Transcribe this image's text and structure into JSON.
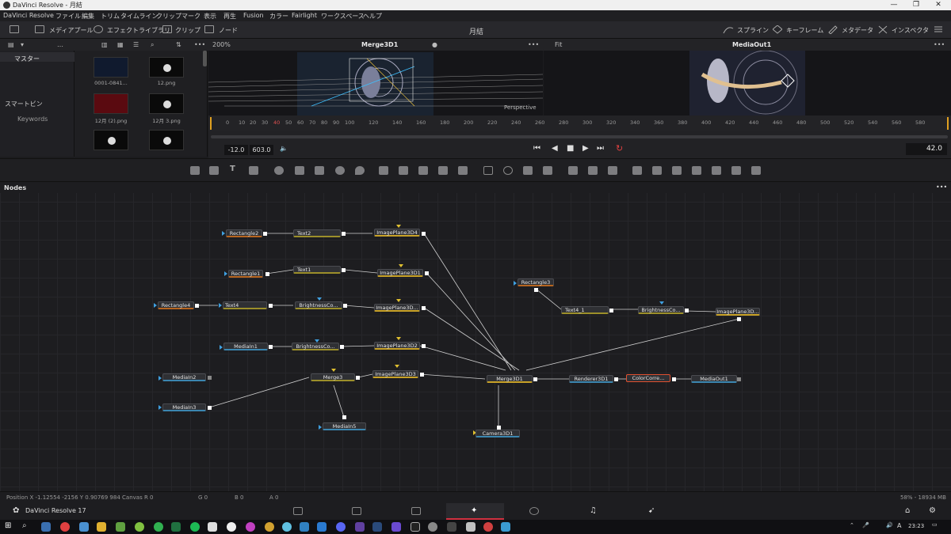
{
  "window": {
    "title": "DaVinci Resolve - 月結",
    "minimize": "—",
    "restore": "❐",
    "close": "✕"
  },
  "menu": [
    "DaVinci Resolve",
    "ファイル",
    "編集",
    "トリム",
    "タイムライン",
    "クリップ",
    "マーク",
    "表示",
    "再生",
    "Fusion",
    "カラー",
    "Fairlight",
    "ワークスペース",
    "ヘルプ"
  ],
  "toolbar": {
    "media_pool": "メディアプール",
    "effects_library": "エフェクトライブラリ",
    "clips": "クリップ",
    "nodes": "ノード",
    "project_name": "月結",
    "spline": "スプライン",
    "keyframes": "キーフレーム",
    "metadata": "メタデータ",
    "inspector": "インスペクタ"
  },
  "subbar": {
    "zoom_left": "200%",
    "viewer_left_name": "Merge3D1",
    "fit": "Fit",
    "viewer_right_name": "MediaOut1",
    "more": "•••"
  },
  "media_pool": {
    "master": "マスター",
    "smart_bins": "スマートビン",
    "keywords": "Keywords",
    "clips": [
      {
        "name": "0001-0841..."
      },
      {
        "name": "12.png"
      },
      {
        "name": "12月 (2).png"
      },
      {
        "name": "12月 3.png"
      },
      {
        "name": ""
      },
      {
        "name": ""
      }
    ]
  },
  "viewer_left": {
    "label": "Perspective"
  },
  "ruler": [
    "0",
    "10",
    "20",
    "30",
    "40",
    "50",
    "60",
    "70",
    "80",
    "90",
    "100",
    "120",
    "140",
    "160",
    "180",
    "200",
    "220",
    "240",
    "260",
    "280",
    "300",
    "320",
    "340",
    "360",
    "380",
    "400",
    "420",
    "440",
    "460",
    "480",
    "500",
    "520",
    "540",
    "560",
    "580"
  ],
  "transport": {
    "in_time": "-12.0",
    "out_time": "603.0",
    "current_frame": "42.0"
  },
  "nodes_panel": {
    "title": "Nodes",
    "more": "•••"
  },
  "nodes": {
    "rectangle2": "Rectangle2",
    "text2": "Text2",
    "imageplane3d4": "ImagePlane3D4",
    "rectangle1": "Rectangle1",
    "text1": "Text1",
    "imageplane3d1": "ImagePlane3D1",
    "rectangle4": "Rectangle4",
    "text4": "Text4",
    "brightness1": "BrightnessCo...",
    "imageplane3d_a": "ImagePlane3D...",
    "mediain1": "MediaIn1",
    "brightness2": "BrightnessCo...",
    "imageplane3d2": "ImagePlane3D2",
    "mediain2": "MediaIn2",
    "merge3": "Merge3",
    "imageplane3d3": "ImagePlane3D3",
    "mediain3": "MediaIn3",
    "mediain5": "MediaIn5",
    "rectangle3": "Rectangle3",
    "text4_1": "Text4_1",
    "brightness3": "BrightnessCo...",
    "imageplane3d_b": "ImagePlane3D...",
    "merge3d1": "Merge3D1",
    "renderer3d1": "Renderer3D1",
    "colorcorrector": "ColorCorre...",
    "mediaout1": "MediaOut1",
    "camera3d1": "Camera3D1"
  },
  "status": {
    "position": "Position  X -1.12554   -2156  Y 0.90769    984    Canvas  R 0",
    "g": "G 0",
    "b": "B 0",
    "a": "A 0",
    "memory": "58% - 18934 MB"
  },
  "pagebar": {
    "app": "DaVinci Resolve 17"
  },
  "taskbar": {
    "time": "23:23",
    "ime": "A"
  }
}
